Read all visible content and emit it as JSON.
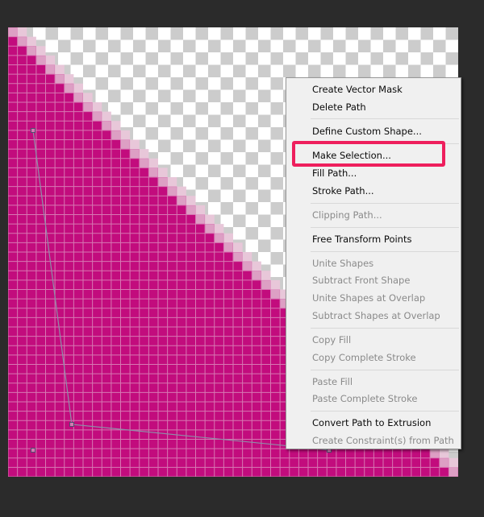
{
  "colors": {
    "shape_fill": "#c20c7d",
    "pixel_grid": "#d777b2",
    "edge_pixel": "#dd9fc4",
    "edge_pixel_light": "#e8c7d9",
    "checker_light": "#ffffff",
    "checker_dark": "#cccccc",
    "path_line": "#8d8fa8",
    "highlight": "#ee1f5d",
    "app_background": "#2b2b2b"
  },
  "context_menu": {
    "items": [
      {
        "label": "Create Vector Mask",
        "enabled": true
      },
      {
        "label": "Delete Path",
        "enabled": true
      },
      {
        "separator": true
      },
      {
        "label": "Define Custom Shape...",
        "enabled": true
      },
      {
        "separator": true
      },
      {
        "label": "Make Selection...",
        "enabled": true,
        "highlighted": true
      },
      {
        "label": "Fill Path...",
        "enabled": true
      },
      {
        "label": "Stroke Path...",
        "enabled": true
      },
      {
        "separator": true
      },
      {
        "label": "Clipping Path...",
        "enabled": false
      },
      {
        "separator": true
      },
      {
        "label": "Free Transform Points",
        "enabled": true
      },
      {
        "separator": true
      },
      {
        "label": "Unite Shapes",
        "enabled": false
      },
      {
        "label": "Subtract Front Shape",
        "enabled": false
      },
      {
        "label": "Unite Shapes at Overlap",
        "enabled": false
      },
      {
        "label": "Subtract Shapes at Overlap",
        "enabled": false
      },
      {
        "separator": true
      },
      {
        "label": "Copy Fill",
        "enabled": false
      },
      {
        "label": "Copy Complete Stroke",
        "enabled": false
      },
      {
        "separator": true
      },
      {
        "label": "Paste Fill",
        "enabled": false
      },
      {
        "label": "Paste Complete Stroke",
        "enabled": false
      },
      {
        "separator": true
      },
      {
        "label": "Convert Path to Extrusion",
        "enabled": true
      },
      {
        "label": "Create Constraint(s) from Path",
        "enabled": false
      }
    ]
  }
}
